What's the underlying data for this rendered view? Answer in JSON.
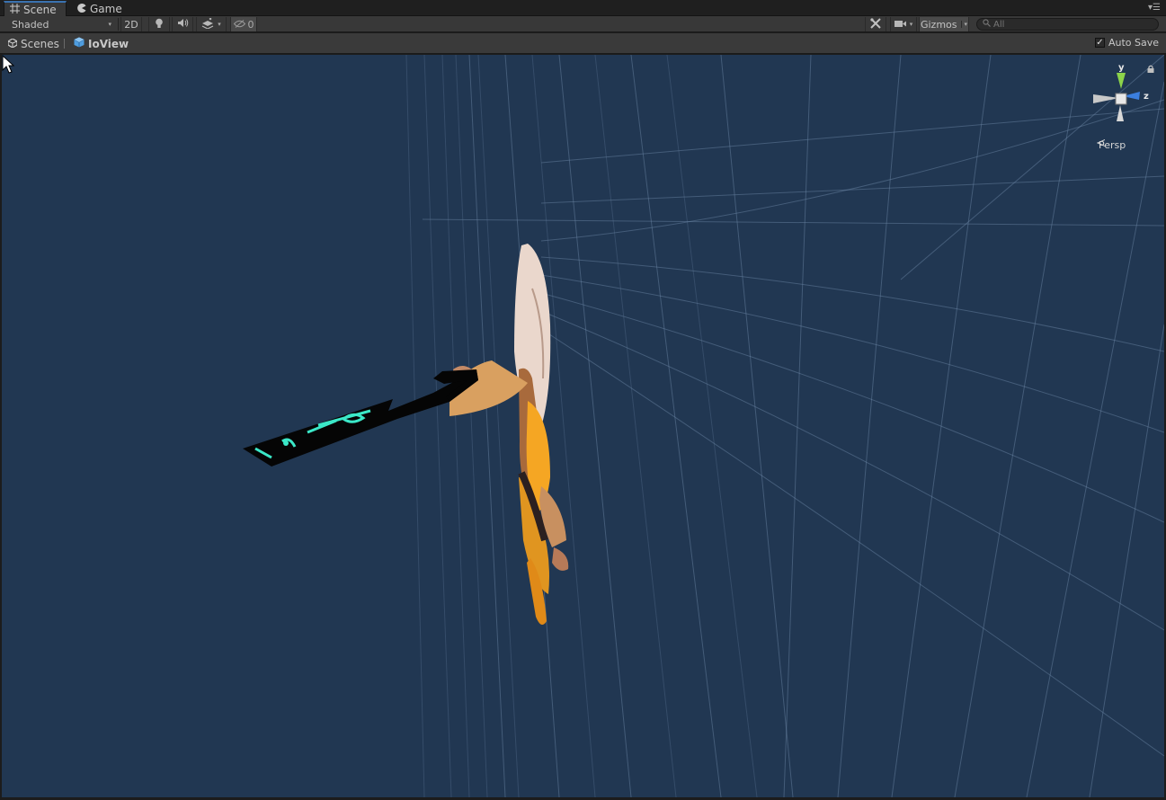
{
  "tabs": [
    {
      "label": "Scene",
      "active": true,
      "icon": "grid-icon"
    },
    {
      "label": "Game",
      "active": false,
      "icon": "pacman-icon"
    }
  ],
  "toolbar": {
    "shading_mode": "Shaded",
    "mode_2d": "2D",
    "hidden_count": "0",
    "gizmos_label": "Gizmos",
    "search_placeholder": "All"
  },
  "breadcrumb": {
    "scenes_label": "Scenes",
    "prefab_label": "IoView"
  },
  "autosave": {
    "label": "Auto Save",
    "checked": true
  },
  "scene_gizmo": {
    "y_label": "y",
    "z_label": "z",
    "projection_label": "Persp"
  },
  "colors": {
    "viewport_bg": "#213752",
    "tab_active_accent": "#3a72b0",
    "gizmo_y": "#8cd34a",
    "gizmo_z": "#3b7fe0",
    "sword_glow": "#3be8c8"
  }
}
